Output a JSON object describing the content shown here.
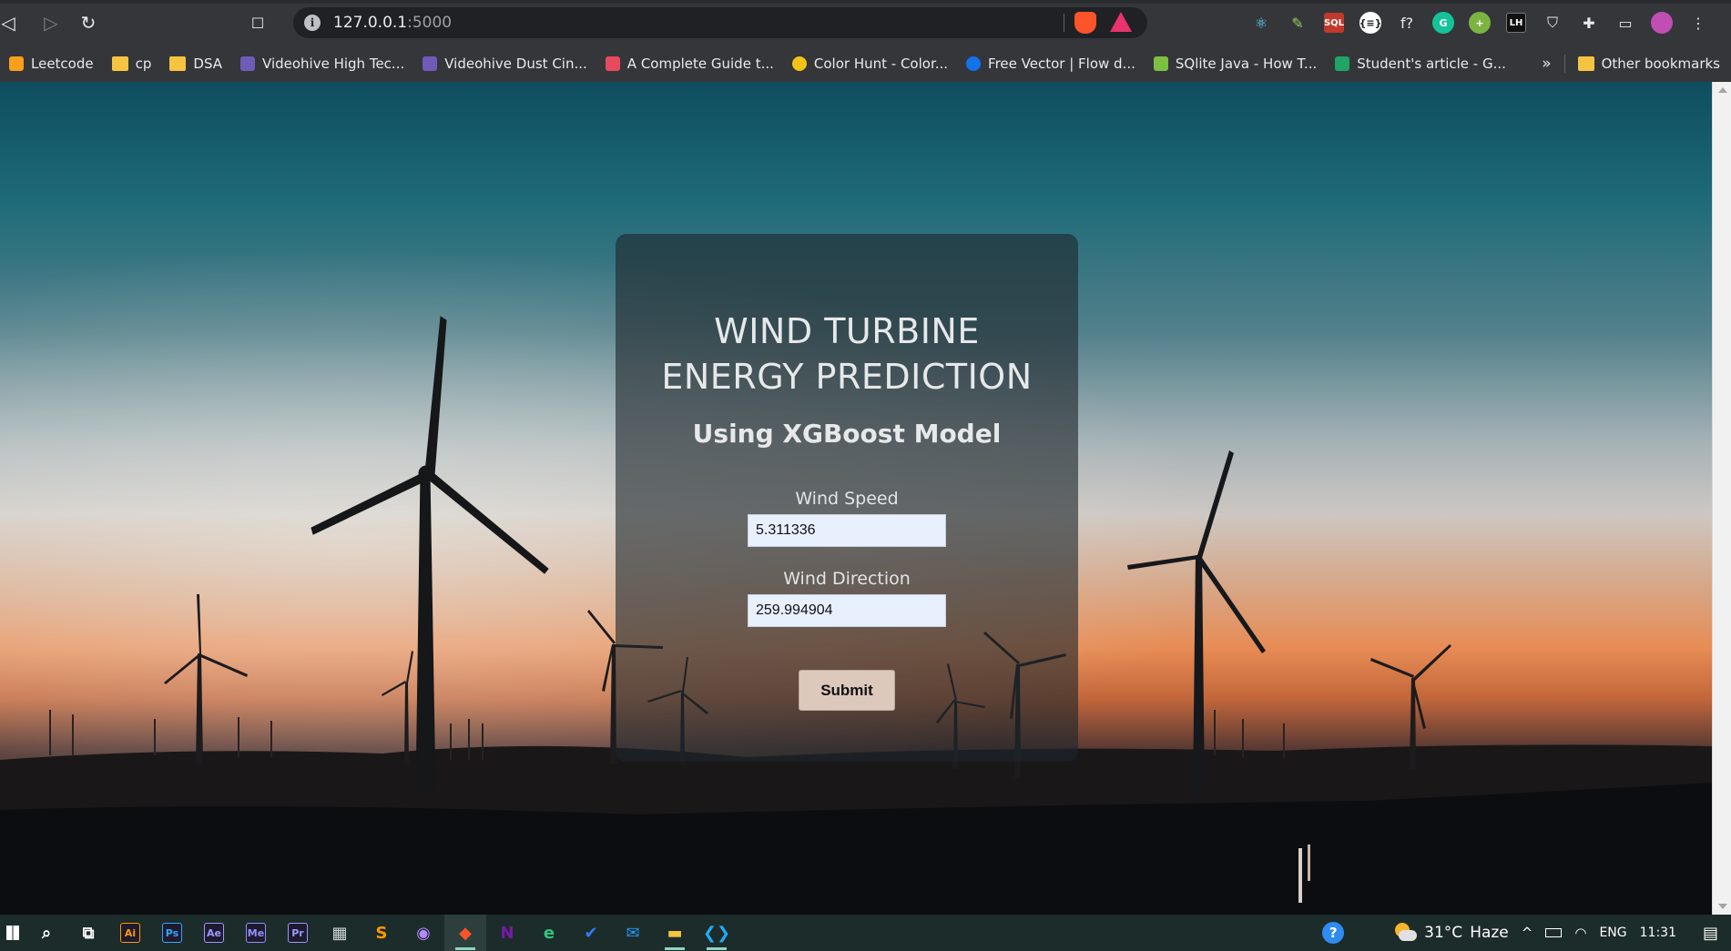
{
  "browser": {
    "url_host": "127.0.0.1",
    "url_port": ":5000",
    "info_glyph": "i",
    "nav": {
      "back_glyph": "◁",
      "forward_glyph": "▷",
      "reload_glyph": "↻",
      "bookmark_glyph": "☐"
    },
    "extensions": [
      {
        "name": "react-devtools-icon",
        "glyph": "⚛",
        "color": "#61dafb"
      },
      {
        "name": "pen-extension-icon",
        "glyph": "✎",
        "color": "#9ccc65"
      },
      {
        "name": "sql-extension-icon",
        "glyph": "SQL",
        "color": "#c0392b"
      },
      {
        "name": "json-formatter-icon",
        "glyph": "{≡}",
        "color": "#ffffff"
      },
      {
        "name": "formula-extension-icon",
        "glyph": "f?",
        "color": "#e8eaed"
      },
      {
        "name": "grammarly-icon",
        "glyph": "G",
        "color": "#15c39a"
      },
      {
        "name": "add-extension-icon",
        "glyph": "+",
        "color": "#7cb342"
      },
      {
        "name": "lighthouse-icon",
        "glyph": "LH",
        "color": "#e8eaed"
      },
      {
        "name": "shield-extension-icon",
        "glyph": "⛉",
        "color": "#e8eaed"
      },
      {
        "name": "puzzle-extensions-icon",
        "glyph": "✚",
        "color": "#e8eaed"
      },
      {
        "name": "wallet-icon",
        "glyph": "▭",
        "color": "#e8eaed"
      },
      {
        "name": "profile-avatar-icon",
        "glyph": "",
        "color": "#c04eb3"
      },
      {
        "name": "menu-kebab-icon",
        "glyph": "⋮",
        "color": "#e8eaed"
      }
    ]
  },
  "bookmarks": {
    "items": [
      {
        "label": "Leetcode",
        "icon": "leetcode-icon",
        "color": "#f89f1b"
      },
      {
        "label": "cp",
        "icon": "folder-icon",
        "color": "#f5c441"
      },
      {
        "label": "DSA",
        "icon": "folder-icon",
        "color": "#f5c441"
      },
      {
        "label": "Videohive High Tec...",
        "icon": "ae-icon",
        "color": "#6f5cb8"
      },
      {
        "label": "Videohive Dust Cin...",
        "icon": "ae-icon",
        "color": "#6f5cb8"
      },
      {
        "label": "A Complete Guide t...",
        "icon": "asterisk-icon",
        "color": "#e64a5f"
      },
      {
        "label": "Color Hunt - Color...",
        "icon": "colorhunt-icon",
        "color": "#f2c318"
      },
      {
        "label": "Free Vector | Flow d...",
        "icon": "freepik-icon",
        "color": "#1273eb"
      },
      {
        "label": "SQlite Java - How T...",
        "icon": "sqlite-icon",
        "color": "#7bc043"
      },
      {
        "label": "Student's article - G...",
        "icon": "google-drive-icon",
        "color": "#1fa463"
      }
    ],
    "overflow_glyph": "»",
    "other_label": "Other bookmarks"
  },
  "page": {
    "title_line1": "WIND TURBINE",
    "title_line2": "ENERGY PREDICTION",
    "subtitle": "Using XGBoost Model",
    "wind_speed_label": "Wind Speed",
    "wind_speed_value": "5.311336",
    "wind_direction_label": "Wind Direction",
    "wind_direction_value": "259.994904",
    "submit_label": "Submit"
  },
  "taskbar": {
    "apps": [
      {
        "name": "start-button",
        "glyph": "",
        "color": "#ffffff"
      },
      {
        "name": "search-icon",
        "glyph": "⌕",
        "color": "#ffffff"
      },
      {
        "name": "task-view-icon",
        "glyph": "⧉",
        "color": "#ffffff"
      },
      {
        "name": "illustrator-icon",
        "glyph": "Ai",
        "color": "#ff9a00"
      },
      {
        "name": "photoshop-icon",
        "glyph": "Ps",
        "color": "#31a8ff"
      },
      {
        "name": "after-effects-icon",
        "glyph": "Ae",
        "color": "#9999ff"
      },
      {
        "name": "media-encoder-icon",
        "glyph": "Me",
        "color": "#8f90ff"
      },
      {
        "name": "premiere-icon",
        "glyph": "Pr",
        "color": "#9999ff"
      },
      {
        "name": "calculator-icon",
        "glyph": "▦",
        "color": "#cfd8dc"
      },
      {
        "name": "sublime-text-icon",
        "glyph": "S",
        "color": "#ff9800"
      },
      {
        "name": "github-desktop-icon",
        "glyph": "◉",
        "color": "#b388ff"
      },
      {
        "name": "brave-browser-icon",
        "glyph": "◆",
        "color": "#fb542b"
      },
      {
        "name": "onenote-icon",
        "glyph": "N",
        "color": "#7719aa"
      },
      {
        "name": "edge-icon",
        "glyph": "e",
        "color": "#33c481"
      },
      {
        "name": "todo-icon",
        "glyph": "✔",
        "color": "#2f7cf6"
      },
      {
        "name": "mail-icon",
        "glyph": "✉",
        "color": "#2196f3"
      },
      {
        "name": "file-explorer-icon",
        "glyph": "▬",
        "color": "#f5c441"
      },
      {
        "name": "vscode-icon",
        "glyph": "❮❯",
        "color": "#23a9f2"
      }
    ],
    "tray": {
      "help_glyph": "?",
      "temperature": "31°C",
      "weather": "Haze",
      "chevron_glyph": "^",
      "language": "ENG",
      "time": "11:31",
      "notification_glyph": "▤"
    }
  }
}
